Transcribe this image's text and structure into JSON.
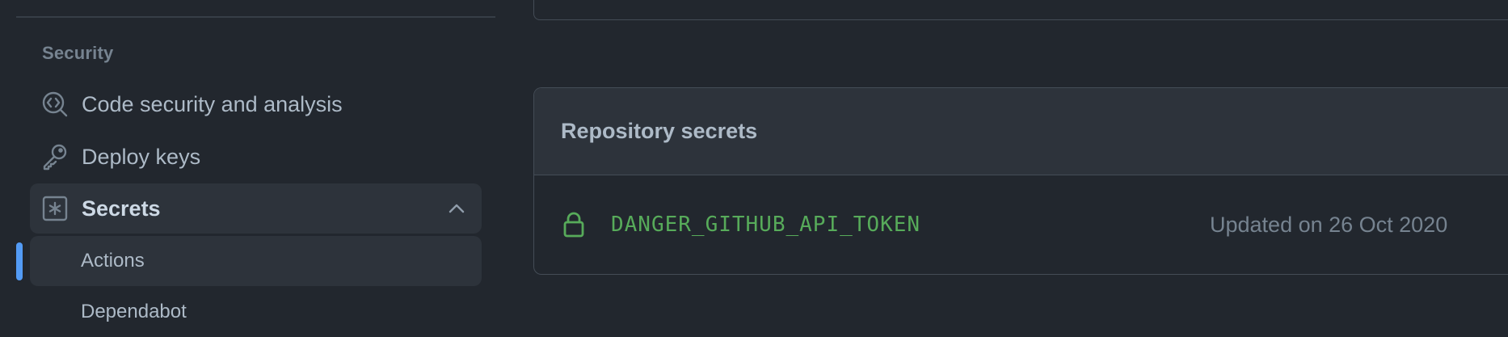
{
  "sidebar": {
    "section_heading": "Security",
    "items": [
      {
        "label": "Code security and analysis",
        "icon": "codescan-icon"
      },
      {
        "label": "Deploy keys",
        "icon": "key-icon"
      },
      {
        "label": "Secrets",
        "icon": "asterisk-box-icon",
        "expanded": true
      }
    ],
    "sub_items": [
      {
        "label": "Actions",
        "selected": true
      },
      {
        "label": "Dependabot",
        "selected": false
      }
    ]
  },
  "main": {
    "repository_secrets": {
      "title": "Repository secrets",
      "rows": [
        {
          "name": "DANGER_GITHUB_API_TOKEN",
          "updated": "Updated on 26 Oct 2020",
          "icon": "lock-icon"
        }
      ]
    }
  },
  "colors": {
    "background": "#22272e",
    "accent": "#539bf5",
    "secret_name": "#57ab5a"
  }
}
